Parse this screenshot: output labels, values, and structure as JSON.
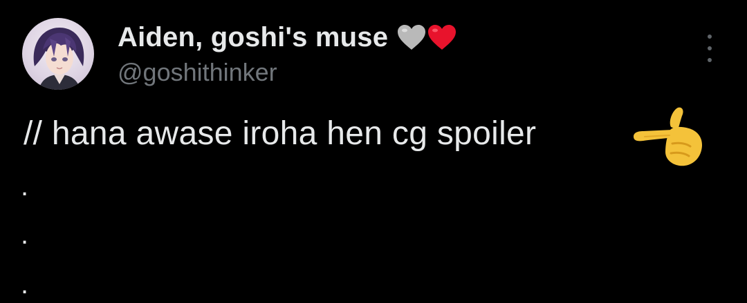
{
  "author": {
    "display_name": "Aiden, goshi's muse",
    "handle": "@goshithinker",
    "name_emojis": [
      "grey-heart-icon",
      "red-heart-icon"
    ],
    "avatar": "avatar-icon"
  },
  "tweet": {
    "text": "// hana awase iroha hen cg spoiler",
    "trailing_emoji": "backhand-index-pointing-right-icon",
    "continuation_lines": [
      ".",
      ".",
      "."
    ]
  },
  "actions": {
    "more_icon": "more-options-icon"
  },
  "colors": {
    "background": "#000000",
    "primary_text": "#e7e9ea",
    "secondary_text": "#71767b",
    "grey_heart": "#b9b9b9",
    "red_heart": "#e8132c",
    "emoji_hand": "#f4c23a"
  }
}
